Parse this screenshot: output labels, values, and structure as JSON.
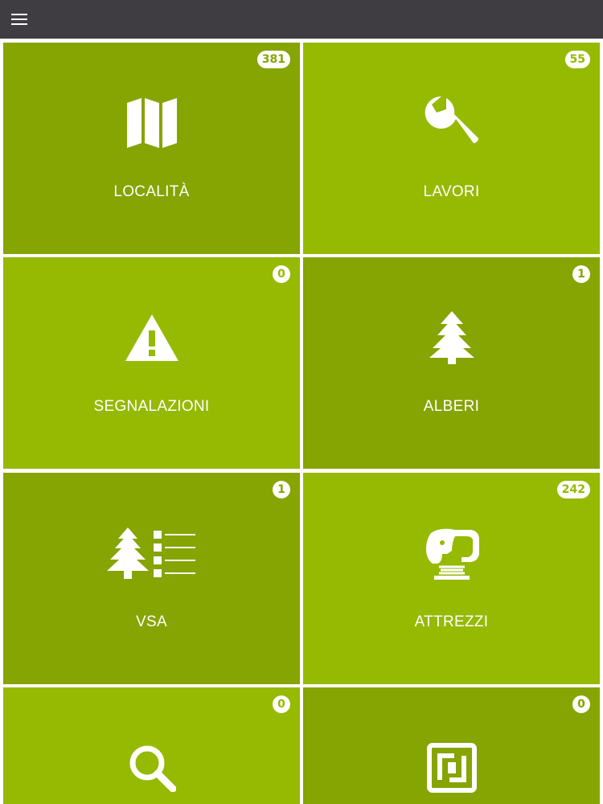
{
  "appbar": {
    "menu_icon": "hamburger-menu-icon",
    "background": "#3f3d42"
  },
  "colors": {
    "tile_dark": "#86a402",
    "tile_light": "#96b902",
    "text": "#ffffff"
  },
  "tiles": [
    {
      "label": "LOCALITÀ",
      "count": "381",
      "icon": "map-icon"
    },
    {
      "label": "LAVORI",
      "count": "55",
      "icon": "wrench-icon"
    },
    {
      "label": "SEGNALAZIONI",
      "count": "0",
      "icon": "warning-icon"
    },
    {
      "label": "ALBERI",
      "count": "1",
      "icon": "tree-icon"
    },
    {
      "label": "VSA",
      "count": "1",
      "icon": "tree-list-icon"
    },
    {
      "label": "ATTREZZI",
      "count": "242",
      "icon": "spring-rider-icon"
    },
    {
      "label": "",
      "count": "0",
      "icon": "search-icon"
    },
    {
      "label": "",
      "count": "0",
      "icon": "nfc-icon"
    }
  ]
}
